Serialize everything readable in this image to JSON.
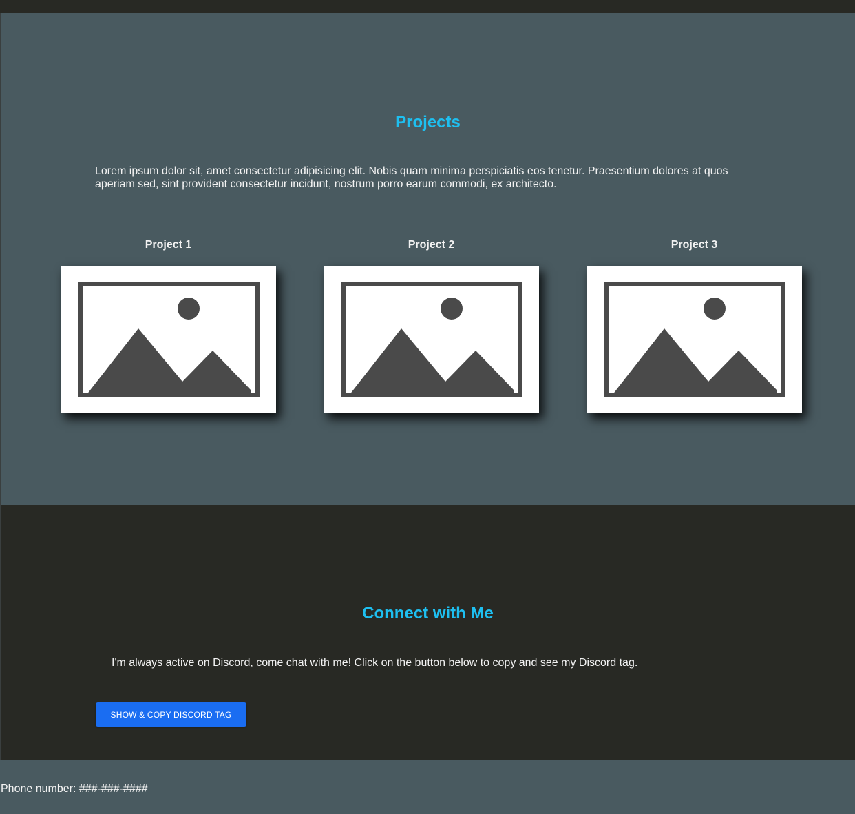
{
  "colors": {
    "accent": "#1ebff0",
    "section_light": "#495a60",
    "section_dark": "#282924",
    "button": "#1a6df2"
  },
  "projects": {
    "title": "Projects",
    "description": "Lorem ipsum dolor sit, amet consectetur adipisicing elit. Nobis quam minima perspiciatis eos tenetur. Praesentium dolores at quos aperiam sed, sint provident consectetur incidunt, nostrum porro earum commodi, ex architecto.",
    "cards": [
      {
        "title": "Project 1",
        "icon": "image-placeholder-icon"
      },
      {
        "title": "Project 2",
        "icon": "image-placeholder-icon"
      },
      {
        "title": "Project 3",
        "icon": "image-placeholder-icon"
      }
    ]
  },
  "connect": {
    "title": "Connect with Me",
    "description": "I'm always active on Discord, come chat with me! Click on the button below to copy and see my Discord tag.",
    "button_label": "SHOW & COPY DISCORD TAG"
  },
  "footer": {
    "phone_text": "Phone number: ###-###-####"
  }
}
